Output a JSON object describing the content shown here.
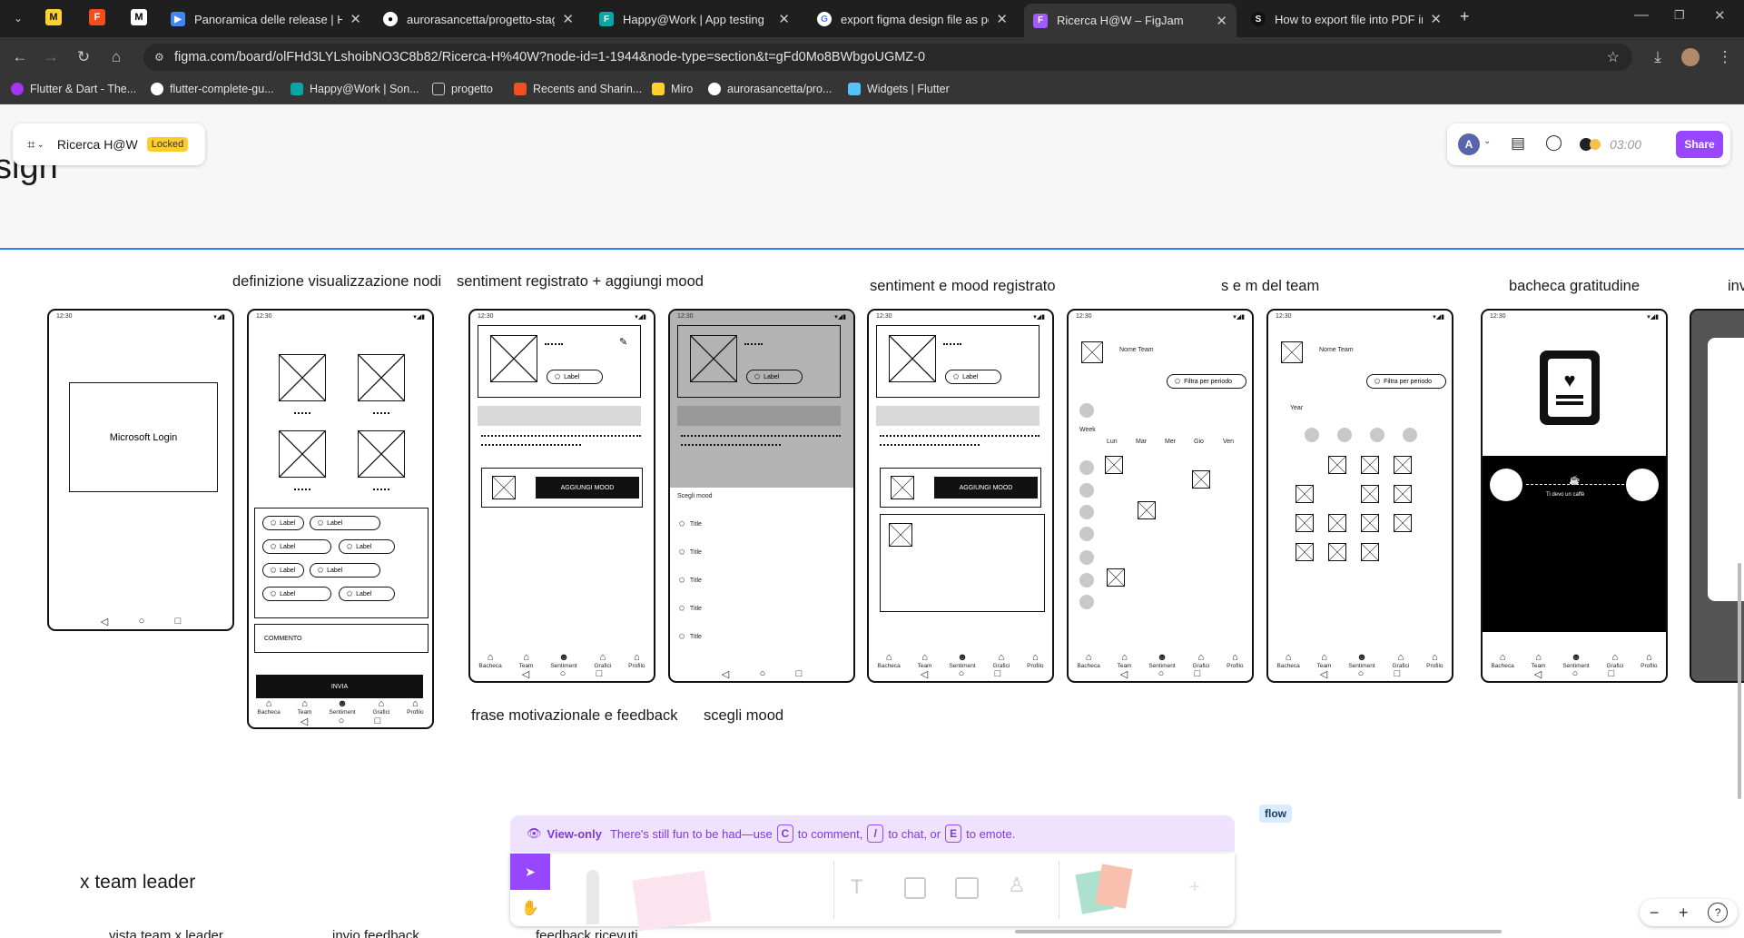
{
  "tabs": [
    {
      "title": "Panoramica delle release | Happ"
    },
    {
      "title": "aurorasancetta/progetto-stage"
    },
    {
      "title": "Happy@Work | App testing"
    },
    {
      "title": "export figma design file as pdf"
    },
    {
      "title": "Ricerca H@W – FigJam"
    },
    {
      "title": "How to export file into PDF in F"
    }
  ],
  "address": {
    "url": "figma.com/board/olFHd3LYLshoibNO3C8b82/Ricerca-H%40W?node-id=1-1944&node-type=section&t=gFd0Mo8BWbgoUGMZ-0"
  },
  "bookmarks": [
    {
      "label": "Flutter & Dart - The..."
    },
    {
      "label": "flutter-complete-gu..."
    },
    {
      "label": "Happy@Work | Son..."
    },
    {
      "label": "progetto"
    },
    {
      "label": "Recents and Sharin..."
    },
    {
      "label": "Miro"
    },
    {
      "label": "aurorasancetta/pro..."
    },
    {
      "label": "Widgets | Flutter"
    }
  ],
  "file": {
    "name": "Ricerca H@W",
    "badge": "Locked"
  },
  "header_right": {
    "avatar": "A",
    "timer": "03:00",
    "share": "Share"
  },
  "board": {
    "section_title": "sign",
    "labels": {
      "definizione": "definizione visualizzazione nodi",
      "sentiment_reg": "sentiment registrato + aggiungi mood",
      "sentiment_mood": "sentiment e mood registrato",
      "sem_team": "s e m del team",
      "bacheca": "bacheca gratitudine",
      "frase": "frase motivazionale e feedback",
      "scegli": "scegli mood",
      "team_leader": "x team leader",
      "cut_inv": "inv",
      "cut_vista": "vista team x leader",
      "cut_invio": "invio feedback",
      "cut_fb": "feedback ricevuti"
    },
    "phone": {
      "time": "12:30",
      "microsoft_login": "Microsoft Login",
      "label": "Label",
      "commento": "COMMENTO",
      "invia": "INVIA",
      "aggiungi_mood": "AGGIUNGI MOOD",
      "scegli_mood": "Scegli mood",
      "title": "Title",
      "nome_team": "Nome Team",
      "filtra": "Filtra per periodo",
      "week": "Week",
      "year": "Year",
      "days": [
        "Lun",
        "Mar",
        "Mer",
        "Gio",
        "Ven"
      ],
      "nav": [
        "Bacheca",
        "Team",
        "Sentiment",
        "Grafici",
        "Profilo"
      ],
      "caffe": "Ti devo un caffè"
    }
  },
  "viewonly": {
    "badge": "View-only",
    "text1": "There's still fun to be had—use",
    "k1": "C",
    "text2": "to comment,",
    "k2": "/",
    "text3": "to chat, or",
    "k3": "E",
    "text4": "to emote."
  },
  "flow_tag": "flow",
  "zoom": {
    "minus": "−",
    "plus": "+",
    "help": "?"
  }
}
